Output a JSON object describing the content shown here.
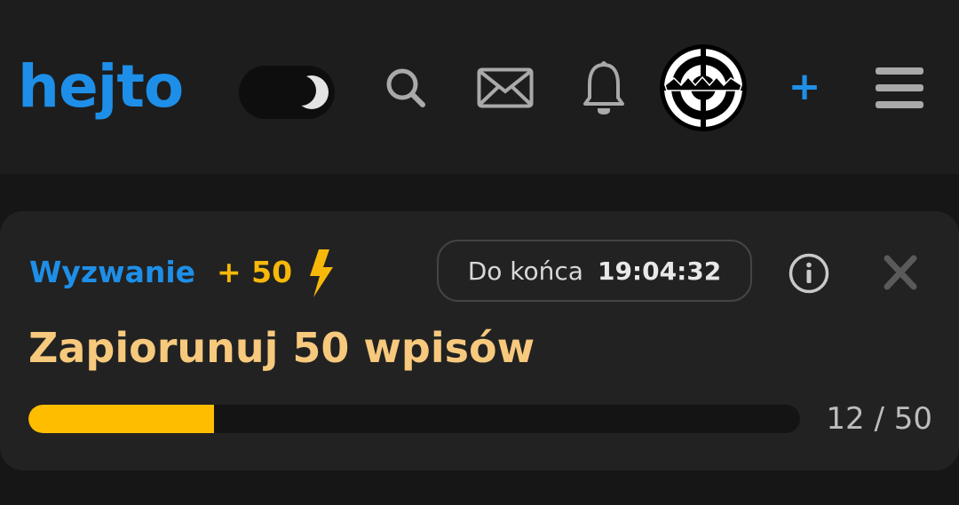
{
  "header": {
    "logo_text": "hejto",
    "theme_toggle_icon": "moon-icon",
    "icons": [
      "search-icon",
      "mail-icon",
      "bell-icon",
      "avatar",
      "plus-icon",
      "menu-icon"
    ],
    "plus_label": "+",
    "accent_color": "#1e8fe8"
  },
  "challenge": {
    "label": "Wyzwanie",
    "points": "+ 50",
    "points_icon": "lightning-icon",
    "timer_label": "Do końca",
    "timer_value": "19:04:32",
    "title": "Zapiorunuj 50 wpisów",
    "progress_current": 12,
    "progress_total": 50,
    "progress_text": "12 / 50",
    "progress_color": "#ffbd00",
    "title_color": "#f7c97d"
  }
}
